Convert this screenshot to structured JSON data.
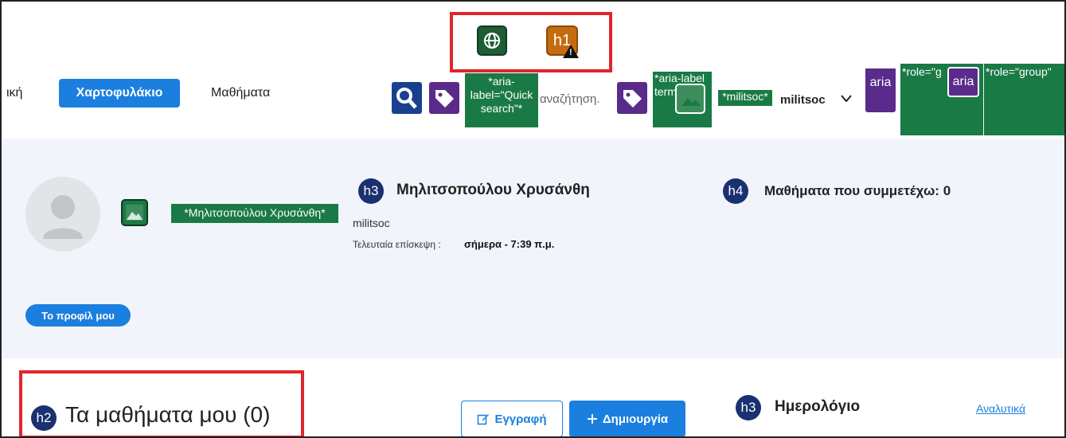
{
  "toolbar": {
    "h1_label": "h1",
    "warn_mark": "!"
  },
  "nav": {
    "partial_item": "ική",
    "active_item": "Χαρτοφυλάκιο",
    "lessons_item": "Μαθήματα",
    "search_aria": "*aria-label=\"Quick search\"*",
    "search_placeholder": "αναζήτηση.",
    "terms_aria": "*aria-label terms",
    "user_tag": "*militsoc*",
    "username": "militsoc",
    "aria_label_1": "aria",
    "aria_label_2": "aria",
    "role_group_1": "*role=\"g",
    "role_group_2": "*role=\"group\""
  },
  "profile": {
    "alt_text": "*Μηλιτσοπούλου Χρυσάνθη*",
    "h3_label": "h3",
    "name": "Μηλιτσοπούλου Χρυσάνθη",
    "username": "militsoc",
    "last_visit_label": "Τελευταία επίσκεψη :",
    "last_visit_value": "σήμερα - 7:39 π.μ.",
    "h4_label": "h4",
    "courses_count": "Μαθήματα που συμμετέχω: 0",
    "my_profile_button": "Το προφίλ μου"
  },
  "main": {
    "h2_label": "h2",
    "my_courses_title": "Τα μαθήματα μου  (0)",
    "register_button": "Εγγραφή",
    "create_button": "Δημιουργία",
    "h3_label": "h3",
    "calendar_title": "Ημερολόγιο",
    "details_link": "Αναλυτικά"
  }
}
